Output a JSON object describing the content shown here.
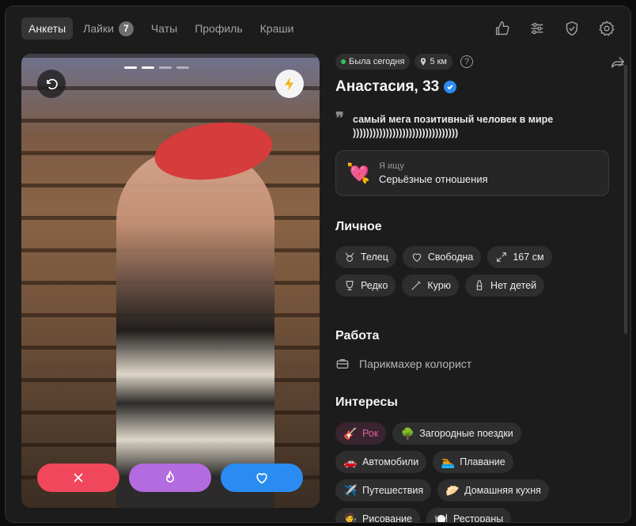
{
  "nav": {
    "tabs": [
      {
        "label": "Анкеты",
        "active": true
      },
      {
        "label": "Лайки",
        "count": "7"
      },
      {
        "label": "Чаты"
      },
      {
        "label": "Профиль"
      },
      {
        "label": "Краши"
      }
    ],
    "icons": [
      "thumbs-up-icon",
      "sliders-icon",
      "shield-check-icon",
      "gear-icon"
    ]
  },
  "photo": {
    "progress_segments": 4,
    "progress_active_index": 0
  },
  "profile": {
    "last_seen": "Была сегодня",
    "distance": "5 км",
    "help": "?",
    "name": "Анастасия, 33",
    "bio": "самый мега позитивный человек в мире ))))))))))))))))))))))))))))))))",
    "looking_label": "Я ищу",
    "looking_value": "Серьёзные отношения"
  },
  "personal": {
    "title": "Личное",
    "chips": [
      {
        "icon": "taurus-icon",
        "label": "Телец"
      },
      {
        "icon": "heart-outline-icon",
        "label": "Свободна"
      },
      {
        "icon": "height-icon",
        "label": "167 см"
      },
      {
        "icon": "glass-icon",
        "label": "Редко"
      },
      {
        "icon": "cigarette-icon",
        "label": "Курю"
      },
      {
        "icon": "bottle-icon",
        "label": "Нет детей"
      }
    ]
  },
  "work": {
    "title": "Работа",
    "value": "Парикмахер колорист"
  },
  "interests": {
    "title": "Интересы",
    "items": [
      {
        "emoji": "🎸",
        "label": "Рок",
        "highlight": true
      },
      {
        "emoji": "🌳",
        "label": "Загородные поездки"
      },
      {
        "emoji": "🚗",
        "label": "Автомобили"
      },
      {
        "emoji": "🏊",
        "label": "Плавание"
      },
      {
        "emoji": "✈️",
        "label": "Путешествия"
      },
      {
        "emoji": "🥟",
        "label": "Домашняя кухня"
      },
      {
        "emoji": "🧑‍🎨",
        "label": "Рисование"
      },
      {
        "emoji": "🍽️",
        "label": "Рестораны"
      }
    ]
  },
  "colors": {
    "dislike": "#f0475c",
    "superlike": "#b36be0",
    "like": "#2a8cf0",
    "online": "#38c45c"
  }
}
